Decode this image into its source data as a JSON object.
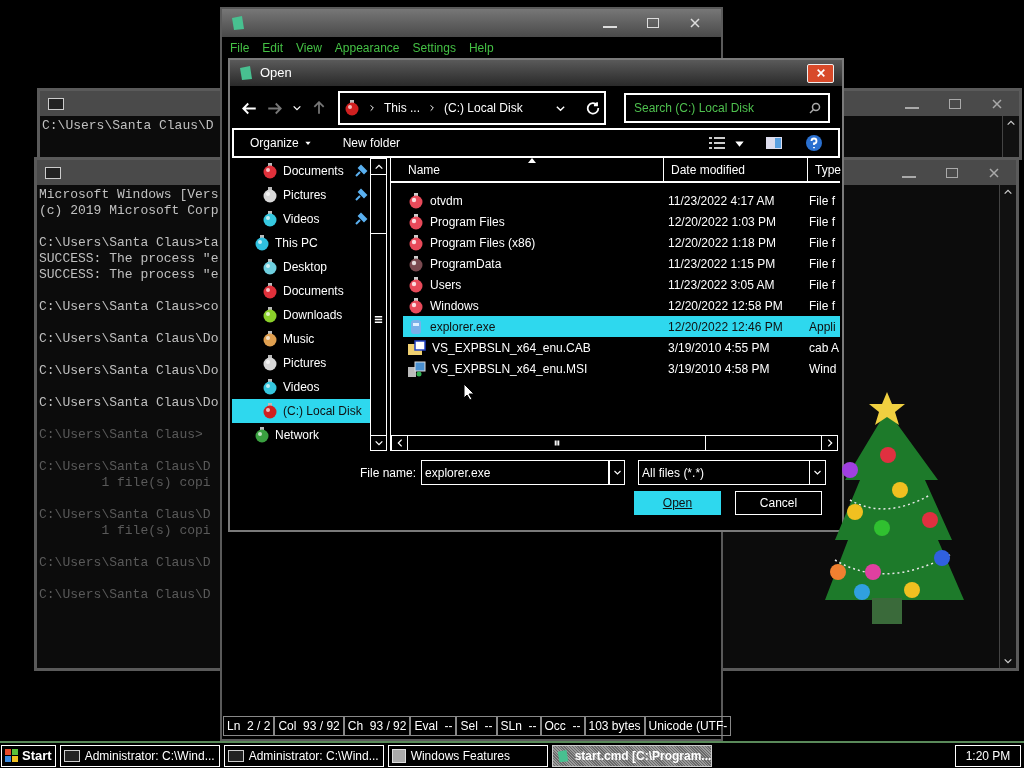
{
  "consoles": [
    {
      "lines": [
        {
          "kind": "text",
          "text": "C:\\Users\\Santa Claus\\D"
        },
        {
          "kind": "blank"
        }
      ]
    },
    {
      "lines": [
        {
          "kind": "text",
          "text": "Microsoft Windows [Vers"
        },
        {
          "kind": "text",
          "text": "(c) 2019 Microsoft Corp"
        },
        {
          "kind": "blank"
        },
        {
          "kind": "text",
          "text": "C:\\Users\\Santa Claus>ta"
        },
        {
          "kind": "text",
          "text": "SUCCESS: The process \"e"
        },
        {
          "kind": "text",
          "text": "SUCCESS: The process \"e"
        },
        {
          "kind": "blank"
        },
        {
          "kind": "text",
          "text": "C:\\Users\\Santa Claus>co"
        },
        {
          "kind": "blank"
        },
        {
          "kind": "text",
          "text": "C:\\Users\\Santa Claus\\Do"
        },
        {
          "kind": "blank"
        },
        {
          "kind": "text",
          "text": "C:\\Users\\Santa Claus\\Do"
        },
        {
          "kind": "blank"
        },
        {
          "kind": "text",
          "text": "C:\\Users\\Santa Claus\\Do"
        },
        {
          "kind": "blank"
        },
        {
          "kind": "dim",
          "text": "C:\\Users\\Santa Claus>"
        },
        {
          "kind": "blank"
        },
        {
          "kind": "dim",
          "text": "C:\\Users\\Santa Claus\\D"
        },
        {
          "kind": "dim",
          "text": "        1 file(s) copi"
        },
        {
          "kind": "blank"
        },
        {
          "kind": "dim",
          "text": "C:\\Users\\Santa Claus\\D"
        },
        {
          "kind": "dim",
          "text": "        1 file(s) copi"
        },
        {
          "kind": "blank"
        },
        {
          "kind": "dim",
          "text": "C:\\Users\\Santa Claus\\D"
        },
        {
          "kind": "blank"
        },
        {
          "kind": "dim",
          "text": "C:\\Users\\Santa Claus\\D"
        }
      ]
    }
  ],
  "notepad": {
    "menu": [
      "File",
      "Edit",
      "View",
      "Appearance",
      "Settings",
      "Help"
    ],
    "status_bar": [
      "Ln  2 / 2",
      "Col  93 / 92",
      "Ch  93 / 92",
      "Eval  --",
      "Sel  --",
      "SLn  --",
      "Occ  --",
      "103 bytes",
      "Unicode (UTF-"
    ]
  },
  "open_dialog": {
    "title": "Open",
    "address": [
      "This ...",
      "(C:) Local Disk"
    ],
    "search": {
      "placeholder": "Search (C:) Local Disk"
    },
    "toolbar": {
      "organize": "Organize",
      "new_folder": "New folder"
    },
    "nav": [
      {
        "kind": "documents",
        "label": "Documents",
        "pinned": true,
        "selected": false
      },
      {
        "kind": "pictures",
        "label": "Pictures",
        "pinned": true,
        "selected": false
      },
      {
        "kind": "videos",
        "label": "Videos",
        "pinned": true,
        "selected": false
      },
      {
        "kind": "pc",
        "label": "This PC",
        "pinned": false,
        "selected": false,
        "children": [
          {
            "kind": "desktop",
            "label": "Desktop",
            "selected": false
          },
          {
            "kind": "documents",
            "label": "Documents",
            "selected": false
          },
          {
            "kind": "downloads",
            "label": "Downloads",
            "selected": false
          },
          {
            "kind": "music",
            "label": "Music",
            "selected": false
          },
          {
            "kind": "pictures",
            "label": "Pictures",
            "selected": false
          },
          {
            "kind": "videos",
            "label": "Videos",
            "selected": false
          },
          {
            "kind": "drive",
            "label": "(C:) Local Disk",
            "selected": true
          }
        ]
      },
      {
        "kind": "network",
        "label": "Network",
        "pinned": false,
        "selected": false
      }
    ],
    "columns": [
      "Name",
      "Date modified",
      "Type"
    ],
    "rows": [
      {
        "kind": "folder",
        "name": "otvdm",
        "date": "11/23/2022 4:17 AM",
        "type": "File f",
        "selected": false
      },
      {
        "kind": "folder",
        "name": "Program Files",
        "date": "12/20/2022 1:03 PM",
        "type": "File f",
        "selected": false
      },
      {
        "kind": "folder",
        "name": "Program Files (x86)",
        "date": "12/20/2022 1:18 PM",
        "type": "File f",
        "selected": false
      },
      {
        "kind": "hidden-folder",
        "name": "ProgramData",
        "date": "11/23/2022 1:15 PM",
        "type": "File f",
        "selected": false
      },
      {
        "kind": "folder",
        "name": "Users",
        "date": "11/23/2022 3:05 AM",
        "type": "File f",
        "selected": false
      },
      {
        "kind": "folder",
        "name": "Windows",
        "date": "12/20/2022 12:58 PM",
        "type": "File f",
        "selected": false
      },
      {
        "kind": "app",
        "name": "explorer.exe",
        "date": "12/20/2022 12:46 PM",
        "type": "Appli",
        "selected": true
      },
      {
        "kind": "cab",
        "name": "VS_EXPBSLN_x64_enu.CAB",
        "date": "3/19/2010 4:55 PM",
        "type": "cab A",
        "selected": false
      },
      {
        "kind": "msi",
        "name": "VS_EXPBSLN_x64_enu.MSI",
        "date": "3/19/2010 4:58 PM",
        "type": "Wind",
        "selected": false
      }
    ],
    "file_name": {
      "label": "File name:",
      "value": "explorer.exe"
    },
    "filter": "All files (*.*)",
    "buttons": [
      {
        "label": "Open",
        "default": true
      },
      {
        "label": "Cancel",
        "default": false
      }
    ]
  },
  "taskbar": {
    "start": "Start",
    "tasks": [
      {
        "kind": "console",
        "label": "Administrator: C:\\Wind...",
        "selected": false
      },
      {
        "kind": "console",
        "label": "Administrator: C:\\Wind...",
        "selected": false
      },
      {
        "kind": "features",
        "label": "Windows Features",
        "selected": false
      },
      {
        "kind": "notepad",
        "label": "start.cmd [C:\\Program...",
        "selected": true
      }
    ],
    "clock": "1:20 PM"
  }
}
